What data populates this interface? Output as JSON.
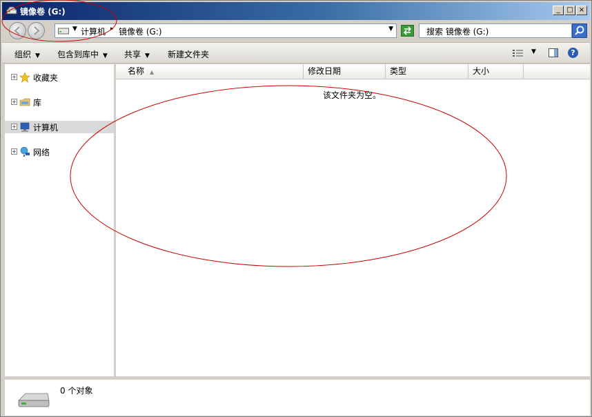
{
  "window": {
    "title": "镜像卷 (G:)",
    "controls": {
      "minimize": "_",
      "maximize": "□",
      "close": "×"
    }
  },
  "address": {
    "crumbs": [
      "计算机",
      "镜像卷 (G:)"
    ],
    "search_placeholder": "搜索 镜像卷 (G:)"
  },
  "toolbar": {
    "organize": "组织",
    "include_in_library": "包含到库中",
    "share": "共享",
    "new_folder": "新建文件夹",
    "help": "?"
  },
  "nav": {
    "items": [
      {
        "label": "收藏夹",
        "icon": "star-icon"
      },
      {
        "label": "库",
        "icon": "library-icon"
      },
      {
        "label": "计算机",
        "icon": "computer-icon",
        "selected": true
      },
      {
        "label": "网络",
        "icon": "network-icon"
      }
    ]
  },
  "columns": {
    "name": "名称",
    "date": "修改日期",
    "type": "类型",
    "size": "大小"
  },
  "content": {
    "empty_message": "该文件夹为空。"
  },
  "details": {
    "count": "0 个对象"
  },
  "colors": {
    "titlebar": "#0a246a",
    "annotation": "#cc0000",
    "selection": "#d9d9d9"
  }
}
